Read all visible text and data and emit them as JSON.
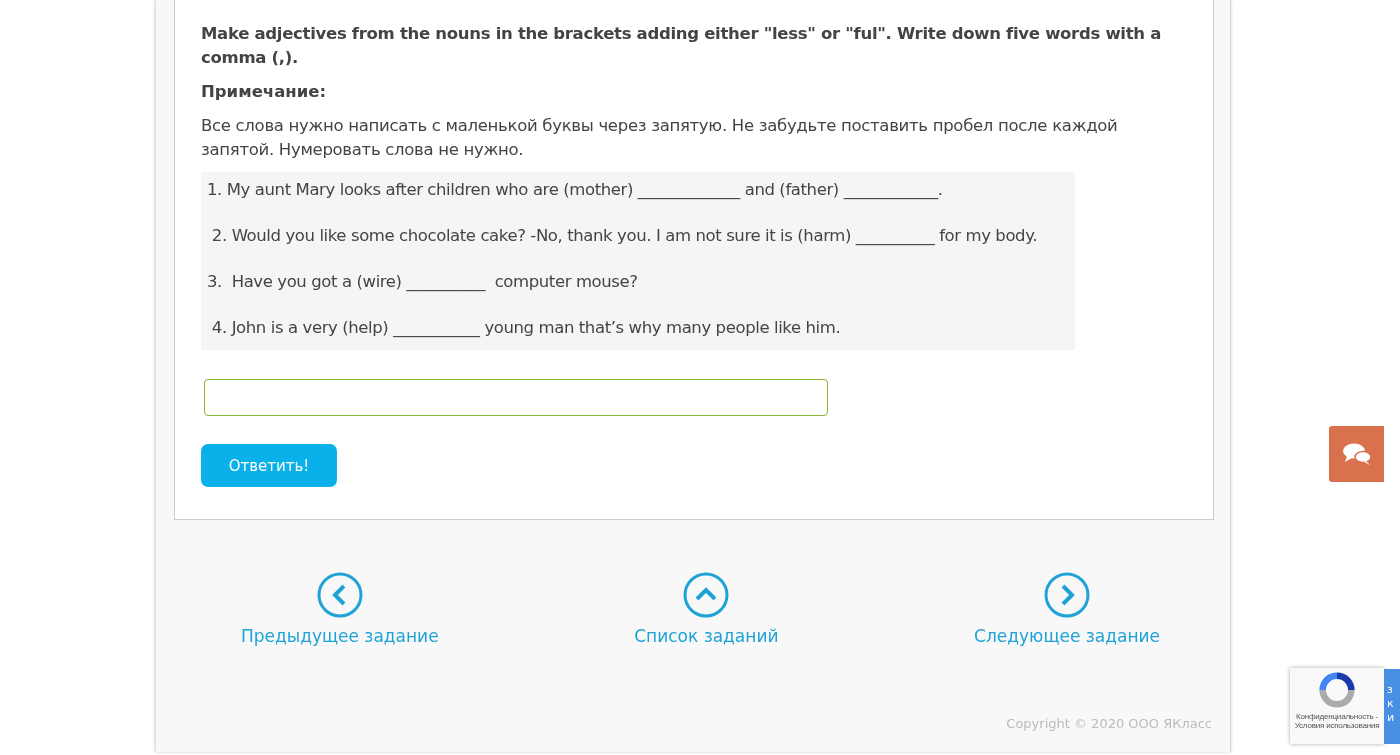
{
  "task": {
    "instruction": "Make adjectives from the nouns in the brackets adding either \"less\" or \"ful\". Write down five words with a comma (,).",
    "note_title": "Примечание:",
    "note": "Все слова нужно написать с маленькой буквы через запятую. Не забудьте поставить пробел после каждой запятой. Нумеровать слова не нужно.",
    "sentences": [
      {
        "text": "1. My aunt Mary looks after children who are (mother) _____________ and (father) ____________."
      },
      {
        "text": " 2. Would you like some chocolate cake? -No, thank you. I am not sure it is (harm) __________ for my body."
      },
      {
        "text": "3.  Have you got a (wire) __________  computer mouse?"
      },
      {
        "text": " 4. John is a very (help) ___________ young man that’s why many people like him."
      }
    ],
    "submit": "Ответить!"
  },
  "nav": [
    {
      "kind": "prev",
      "label": "Предыдущее задание"
    },
    {
      "kind": "list",
      "label": "Список заданий"
    },
    {
      "kind": "next",
      "label": "Следующее задание"
    }
  ],
  "copyright": "Copyright © 2020 ООО ЯКласс",
  "recaptcha": {
    "links": "Конфиденциальность - Условия использования",
    "side_letters": [
      "з",
      "к",
      "и"
    ]
  }
}
